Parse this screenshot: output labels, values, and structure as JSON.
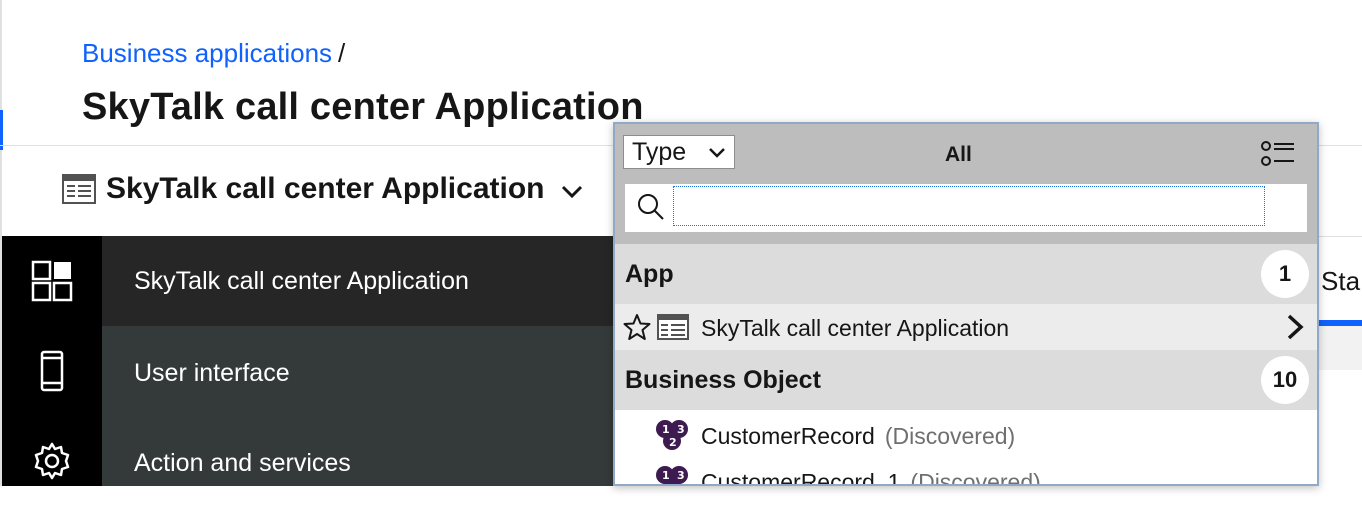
{
  "breadcrumb": {
    "link": "Business applications",
    "separator": "/"
  },
  "page_title": "SkyTalk call center Application",
  "app_switcher": {
    "label": "SkyTalk call center Application",
    "icon": "table-app-icon"
  },
  "rail": [
    {
      "icon": "dashboard-icon"
    },
    {
      "icon": "mobile-device-icon"
    },
    {
      "icon": "gear-icon"
    }
  ],
  "menu": [
    {
      "label": "SkyTalk call center Application",
      "active": true
    },
    {
      "label": "User interface",
      "active": false
    },
    {
      "label": "Action and services",
      "active": false
    }
  ],
  "background": {
    "partial_tab": "Sta"
  },
  "popup": {
    "type_select": "Type",
    "filter_label": "All",
    "search_value": "",
    "groups": [
      {
        "name": "App",
        "count": "1",
        "items": [
          {
            "name": "SkyTalk call center Application"
          }
        ]
      },
      {
        "name": "Business Object",
        "count": "10",
        "items": [
          {
            "name": "CustomerRecord",
            "status": "(Discovered)"
          },
          {
            "name": "CustomerRecord_1",
            "status": "(Discovered)"
          }
        ]
      }
    ]
  },
  "colors": {
    "accent": "#0f62fe",
    "rail": "#000000",
    "menu": "#343a3a",
    "menu_active": "#262626",
    "popup_header": "#bdbdbd",
    "group_header": "#dcdcdc"
  }
}
